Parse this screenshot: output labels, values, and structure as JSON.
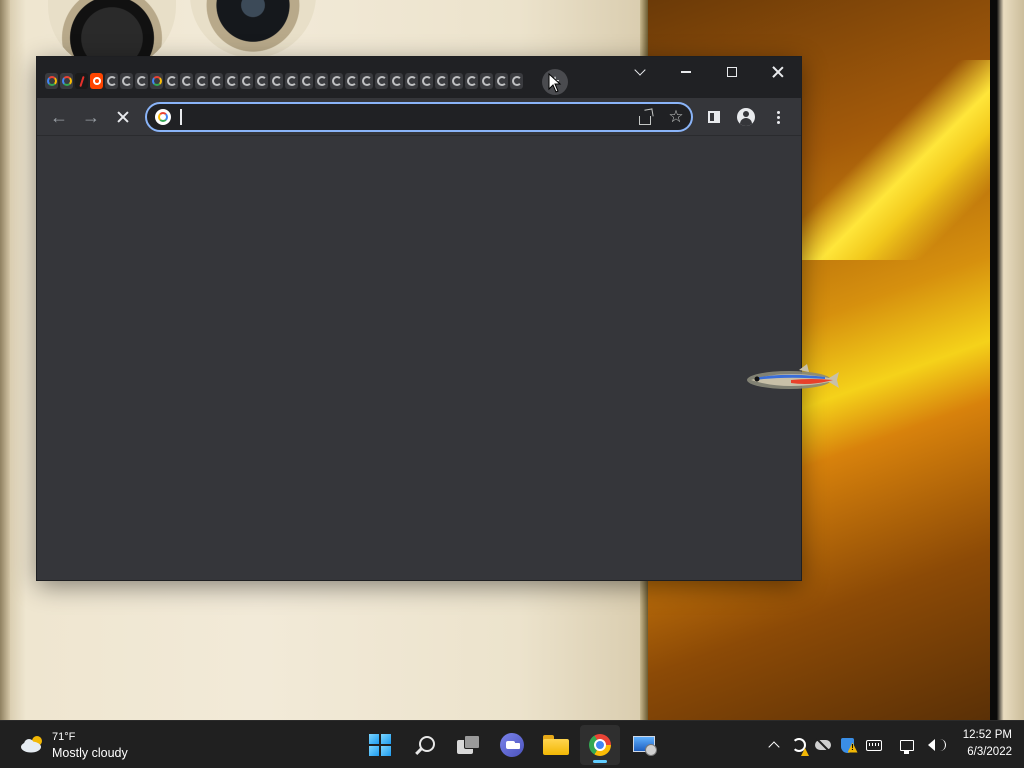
{
  "desktop": {
    "wallpaper": "golden phone wallpaper"
  },
  "browser": {
    "tabs": [
      {
        "favicon": "google-icon",
        "loading": false
      },
      {
        "favicon": "google-icon",
        "loading": false
      },
      {
        "favicon": "verge-icon",
        "loading": false
      },
      {
        "favicon": "reddit-icon",
        "loading": false
      },
      {
        "favicon": "loading-spinner-icon",
        "loading": true
      },
      {
        "favicon": "loading-spinner-icon",
        "loading": true
      },
      {
        "favicon": "loading-spinner-icon",
        "loading": true
      },
      {
        "favicon": "google-icon",
        "loading": false
      },
      {
        "favicon": "loading-spinner-icon",
        "loading": true
      },
      {
        "favicon": "loading-spinner-icon",
        "loading": true
      },
      {
        "favicon": "loading-spinner-icon",
        "loading": true
      },
      {
        "favicon": "loading-spinner-icon",
        "loading": true
      },
      {
        "favicon": "loading-spinner-icon",
        "loading": true
      },
      {
        "favicon": "loading-spinner-icon",
        "loading": true
      },
      {
        "favicon": "loading-spinner-icon",
        "loading": true
      },
      {
        "favicon": "loading-spinner-icon",
        "loading": true
      },
      {
        "favicon": "loading-spinner-icon",
        "loading": true
      },
      {
        "favicon": "loading-spinner-icon",
        "loading": true
      },
      {
        "favicon": "loading-spinner-icon",
        "loading": true
      },
      {
        "favicon": "loading-spinner-icon",
        "loading": true
      },
      {
        "favicon": "loading-spinner-icon",
        "loading": true
      },
      {
        "favicon": "loading-spinner-icon",
        "loading": true
      },
      {
        "favicon": "loading-spinner-icon",
        "loading": true
      },
      {
        "favicon": "loading-spinner-icon",
        "loading": true
      },
      {
        "favicon": "loading-spinner-icon",
        "loading": true
      },
      {
        "favicon": "loading-spinner-icon",
        "loading": true
      },
      {
        "favicon": "loading-spinner-icon",
        "loading": true
      },
      {
        "favicon": "loading-spinner-icon",
        "loading": true
      },
      {
        "favicon": "loading-spinner-icon",
        "loading": true
      },
      {
        "favicon": "loading-spinner-icon",
        "loading": true
      },
      {
        "favicon": "loading-spinner-icon",
        "loading": true
      },
      {
        "favicon": "loading-spinner-icon",
        "loading": true
      }
    ],
    "new_tab_symbol": "+",
    "address_bar": {
      "value": "",
      "placeholder": ""
    },
    "page_state": "loading",
    "theme": {
      "frame": "#202124",
      "toolbar": "#35363a",
      "omnibox": "#202124",
      "focus_ring": "#8ab4f8"
    }
  },
  "taskbar": {
    "weather": {
      "temp": "71°F",
      "condition": "Mostly cloudy"
    },
    "apps": [
      {
        "name": "start",
        "icon": "windows-icon",
        "active": false
      },
      {
        "name": "search",
        "icon": "search-icon",
        "active": false
      },
      {
        "name": "task-view",
        "icon": "task-view-icon",
        "active": false
      },
      {
        "name": "chat",
        "icon": "teams-chat-icon",
        "active": false
      },
      {
        "name": "file-explorer",
        "icon": "folder-icon",
        "active": false
      },
      {
        "name": "chrome",
        "icon": "chrome-icon",
        "active": true
      },
      {
        "name": "remote-desktop",
        "icon": "remote-desktop-icon",
        "active": false
      }
    ],
    "clock": {
      "time": "12:52 PM",
      "date": "6/3/2022"
    },
    "accent": "#60cdff"
  }
}
